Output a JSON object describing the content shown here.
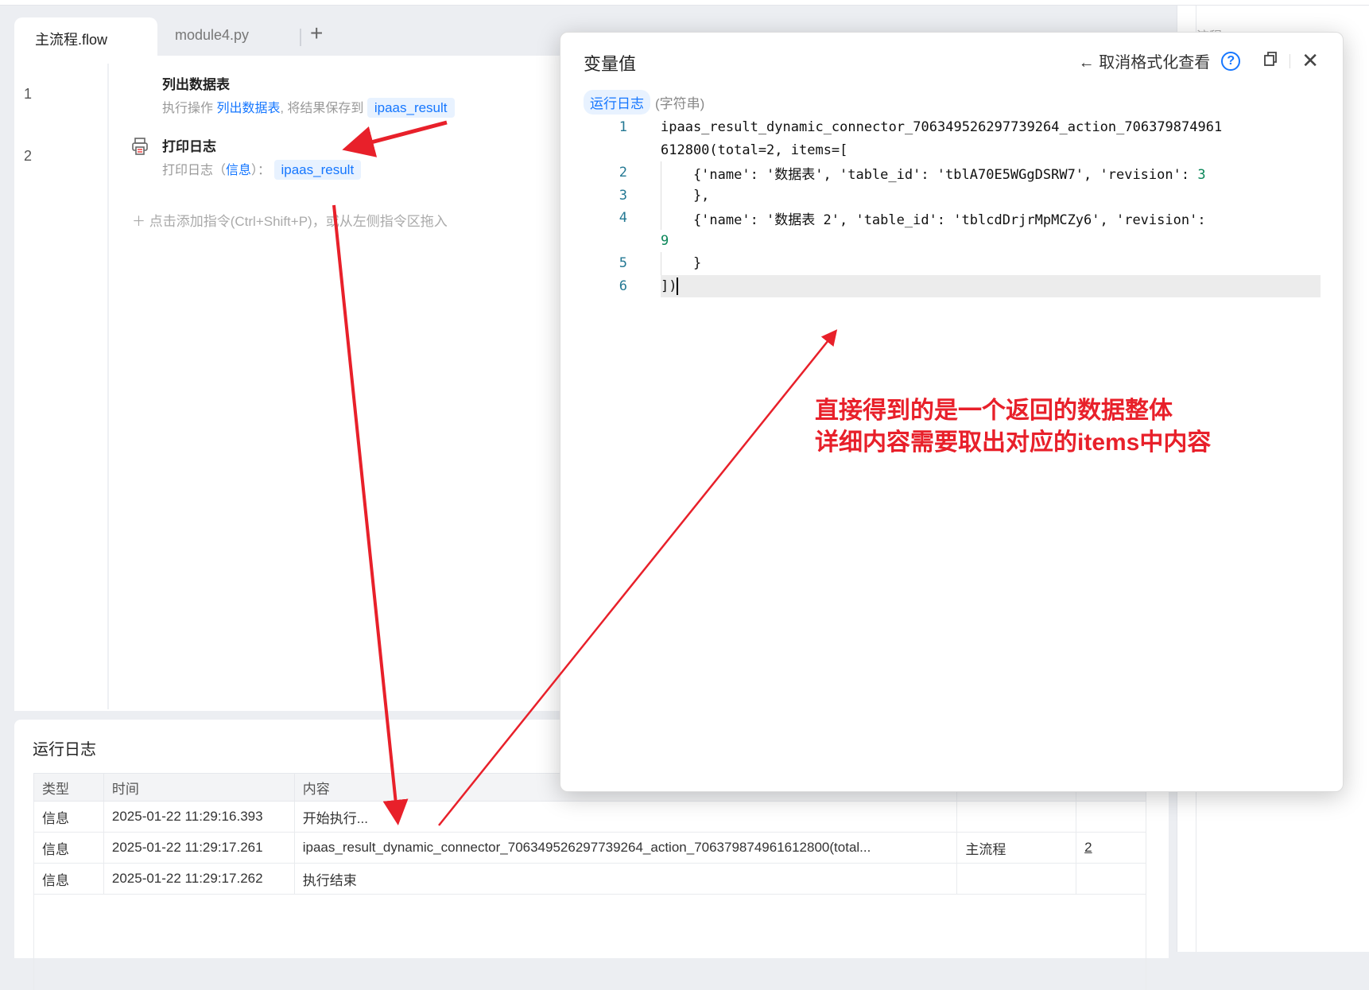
{
  "tabs": [
    {
      "label": "主流程.flow"
    },
    {
      "label": "module4.py"
    }
  ],
  "editor": {
    "steps": [
      {
        "line": "1",
        "title": "列出数据表",
        "desc_prefix": "执行操作",
        "desc_action": "列出数据表",
        "desc_mid": ", 将结果保存到",
        "var": "ipaas_result"
      },
      {
        "line": "2",
        "title": "打印日志",
        "desc_prefix": "打印日志（",
        "desc_action": "信息",
        "desc_mid": "）：",
        "var": "ipaas_result"
      }
    ],
    "add_hint": "点击添加指令(Ctrl+Shift+P)，或从左侧指令区拖入"
  },
  "log": {
    "title": "运行日志",
    "columns": [
      "类型",
      "时间",
      "内容",
      "",
      ""
    ],
    "rows": [
      {
        "type": "信息",
        "time": "2025-01-22 11:29:16.393",
        "content": "开始执行...",
        "flow": "",
        "line": ""
      },
      {
        "type": "信息",
        "time": "2025-01-22 11:29:17.261",
        "content": "ipaas_result_dynamic_connector_706349526297739264_action_706379874961612800(total...",
        "flow": "主流程",
        "line": "2"
      },
      {
        "type": "信息",
        "time": "2025-01-22 11:29:17.262",
        "content": "执行结束",
        "flow": "",
        "line": ""
      }
    ]
  },
  "sidebar": {
    "label": "流程"
  },
  "modal": {
    "title": "变量值",
    "unformat_label": "取消格式化查看",
    "help": "?",
    "var_tag": "运行日志",
    "var_type": "(字符串)",
    "code_rows": [
      {
        "n": "1",
        "text": "ipaas_result_dynamic_connector_706349526297739264_action_706379874961",
        "num": ""
      },
      {
        "n": "",
        "text": "612800(total=2, items=[",
        "num": ""
      },
      {
        "n": "2",
        "text": "    {'name': '数据表', 'table_id': 'tblA70E5WGgDSRW7', 'revision': ",
        "num": "3"
      },
      {
        "n": "3",
        "text": "    },",
        "num": ""
      },
      {
        "n": "4",
        "text": "    {'name': '数据表 2', 'table_id': 'tblcdDrjrMpMCZy6', 'revision':",
        "num": ""
      },
      {
        "n": "",
        "text": "",
        "num": "9"
      },
      {
        "n": "5",
        "text": "    }",
        "num": ""
      },
      {
        "n": "6",
        "text": "])",
        "num": ""
      }
    ]
  },
  "annotation": {
    "line1": "直接得到的是一个返回的数据整体",
    "line2": "详细内容需要取出对应的items中内容"
  },
  "colors": {
    "accent": "#1677ff",
    "annotation": "#e8202a"
  }
}
